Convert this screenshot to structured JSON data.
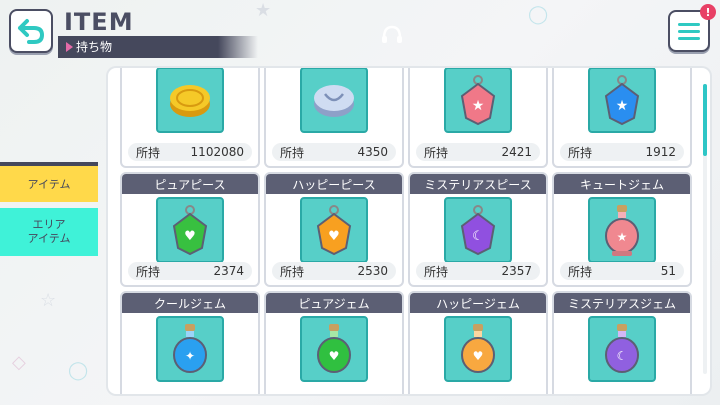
{
  "header": {
    "title": "ITEM",
    "subtitle": "持ち物",
    "back_icon": "back-arrow-icon",
    "menu_icon": "hamburger-menu-icon",
    "notification_badge": "!"
  },
  "tabs": [
    {
      "label": "アイテム",
      "selected": true
    },
    {
      "label": "エリア\nアイテム",
      "selected": false
    }
  ],
  "owned_label": "所持",
  "items_row1": [
    {
      "name": "",
      "count": "1102080",
      "icon": "gold-coin-icon",
      "color": "#f0c020"
    },
    {
      "name": "",
      "count": "4350",
      "icon": "silver-coin-icon",
      "color": "#b8c8e8"
    },
    {
      "name": "",
      "count": "2421",
      "icon": "pink-star-piece-icon",
      "color": "#f07080"
    },
    {
      "name": "",
      "count": "1912",
      "icon": "blue-star-piece-icon",
      "color": "#2a8ef0"
    }
  ],
  "items_row2": [
    {
      "name": "ピュアピース",
      "count": "2374",
      "icon": "green-heart-piece-icon",
      "color": "#38c040"
    },
    {
      "name": "ハッピーピース",
      "count": "2530",
      "icon": "orange-heart-piece-icon",
      "color": "#f8a020"
    },
    {
      "name": "ミステリアスピース",
      "count": "2357",
      "icon": "purple-moon-piece-icon",
      "color": "#9050e0"
    },
    {
      "name": "キュートジェム",
      "count": "51",
      "icon": "pink-jewel-bottle-icon",
      "color": "#f08890"
    }
  ],
  "items_row3": [
    {
      "name": "クールジェム",
      "count": "",
      "icon": "blue-jewel-bottle-icon",
      "color": "#2aa0f0"
    },
    {
      "name": "ピュアジェム",
      "count": "",
      "icon": "green-jewel-bottle-icon",
      "color": "#30c040"
    },
    {
      "name": "ハッピージェム",
      "count": "",
      "icon": "orange-jewel-bottle-icon",
      "color": "#f8a840"
    },
    {
      "name": "ミステリアスジェム",
      "count": "",
      "icon": "purple-jewel-bottle-icon",
      "color": "#9060e0"
    }
  ]
}
